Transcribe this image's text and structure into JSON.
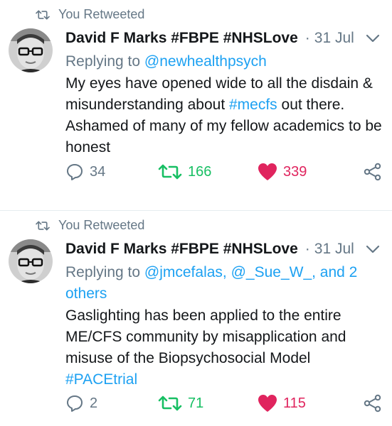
{
  "colors": {
    "retweet_green": "#17bf63",
    "like_red": "#e0245e",
    "link_blue": "#1da1f2",
    "meta_gray": "#657786"
  },
  "tweets": [
    {
      "retweet_label": "You Retweeted",
      "author": "David F Marks #FBPE #NHSLove",
      "separator": "·",
      "date": "31 Jul",
      "reply_prefix": "Replying to",
      "reply_to": "@newhealthpsych",
      "text_before": "My eyes have opened wide to all the disdain & misunderstanding about ",
      "hashtag": "#mecfs",
      "text_after": " out there. Ashamed of many of my fellow academics to be honest",
      "replies": "34",
      "retweets": "166",
      "likes": "339",
      "retweeted": true,
      "liked": true
    },
    {
      "retweet_label": "You Retweeted",
      "author": "David F Marks #FBPE #NHSLove",
      "separator": "·",
      "date": "31 Jul",
      "reply_prefix": "Replying to",
      "reply_to": "@jmcefalas, @_Sue_W_, and 2 others",
      "text_before": "Gaslighting has been applied to the entire ME/CFS community by misapplication and misuse of the Biopsychosocial Model ",
      "hashtag": "#PACEtrial",
      "text_after": "",
      "replies": "2",
      "retweets": "71",
      "likes": "115",
      "retweeted": true,
      "liked": true
    }
  ]
}
